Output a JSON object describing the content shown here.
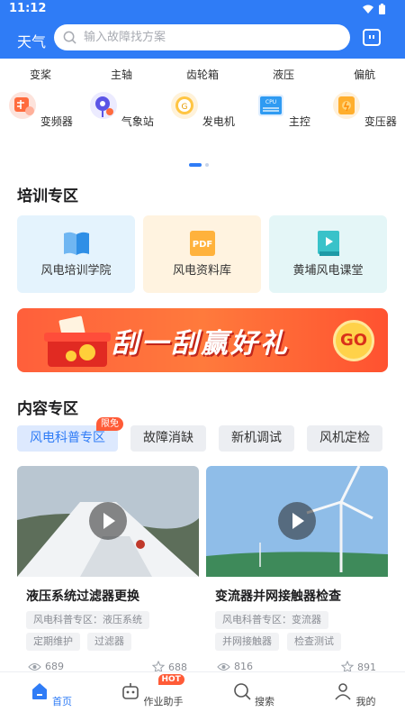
{
  "status_bar": {
    "time": "11:12"
  },
  "header": {
    "title": "天气",
    "search_placeholder": "输入故障找方案"
  },
  "categories_row1": [
    "变桨",
    "主轴",
    "齿轮箱",
    "液压",
    "偏航"
  ],
  "categories_row2": [
    {
      "label": "变频器",
      "icon": "inverter-icon"
    },
    {
      "label": "气象站",
      "icon": "weather-station-icon"
    },
    {
      "label": "发电机",
      "icon": "generator-icon"
    },
    {
      "label": "主控",
      "icon": "cpu-icon"
    },
    {
      "label": "变压器",
      "icon": "transformer-icon"
    }
  ],
  "pager": {
    "pages": 2,
    "current": 1
  },
  "training": {
    "title": "培训专区",
    "cards": [
      {
        "label": "风电培训学院",
        "icon": "book-icon"
      },
      {
        "label": "风电资料库",
        "icon": "pdf-icon",
        "icon_text": "PDF"
      },
      {
        "label": "黄埔风电课堂",
        "icon": "video-lesson-icon"
      }
    ]
  },
  "banner": {
    "text": "刮一刮赢好礼",
    "go": "GO"
  },
  "content": {
    "title": "内容专区",
    "tabs": [
      {
        "label": "风电科普专区",
        "badge": "限免"
      },
      {
        "label": "故障消缺"
      },
      {
        "label": "新机调试"
      },
      {
        "label": "风机定检"
      }
    ],
    "videos": [
      {
        "title": "液压系统过滤器更换",
        "tags": [
          "风电科普专区：液压系统",
          "定期维护",
          "过滤器"
        ],
        "views": "689",
        "likes": "688"
      },
      {
        "title": "变流器并网接触器检查",
        "tags": [
          "风电科普专区：变流器",
          "并网接触器",
          "检查测试"
        ],
        "views": "816",
        "likes": "891"
      }
    ]
  },
  "bottom_nav": [
    {
      "label": "首页",
      "icon": "home-icon",
      "active": true
    },
    {
      "label": "作业助手",
      "icon": "robot-icon",
      "badge": "HOT"
    },
    {
      "label": "搜索",
      "icon": "search-icon"
    },
    {
      "label": "我的",
      "icon": "user-icon"
    }
  ],
  "colors": {
    "primary": "#2f7cf6",
    "accent": "#ff5b37"
  }
}
